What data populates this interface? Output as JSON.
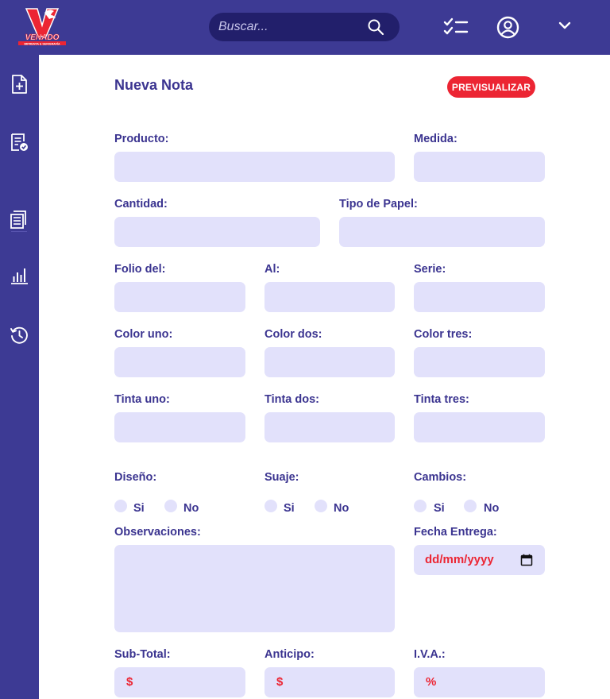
{
  "app": {
    "logo_text": "VENADO",
    "logo_subtitle": "IMPRENTA & SERIGRAFÍA",
    "brand_color": "#3d3a94",
    "accent_color": "#ec2533"
  },
  "topbar": {
    "search_placeholder": "Buscar...",
    "icons": [
      "search-icon",
      "checklist-icon",
      "user-account-icon",
      "chevron-down-icon"
    ]
  },
  "sidebar": {
    "items": [
      {
        "icon": "new-document-icon"
      },
      {
        "icon": "document-check-icon"
      },
      {
        "icon": "notes-list-icon"
      },
      {
        "icon": "bar-chart-icon"
      },
      {
        "icon": "history-icon"
      }
    ]
  },
  "page": {
    "title": "Nueva Nota",
    "preview_button": "PREVISUALIZAR"
  },
  "form": {
    "producto": {
      "label": "Producto:",
      "value": ""
    },
    "medida": {
      "label": "Medida:",
      "value": ""
    },
    "cantidad": {
      "label": "Cantidad:",
      "value": ""
    },
    "tipo_papel": {
      "label": "Tipo de Papel:",
      "value": ""
    },
    "folio_del": {
      "label": "Folio del:",
      "value": ""
    },
    "al": {
      "label": "Al:",
      "value": ""
    },
    "serie": {
      "label": "Serie:",
      "value": ""
    },
    "color_uno": {
      "label": "Color uno:",
      "value": ""
    },
    "color_dos": {
      "label": "Color dos:",
      "value": ""
    },
    "color_tres": {
      "label": "Color tres:",
      "value": ""
    },
    "tinta_uno": {
      "label": "Tinta uno:",
      "value": ""
    },
    "tinta_dos": {
      "label": "Tinta dos:",
      "value": ""
    },
    "tinta_tres": {
      "label": "Tinta tres:",
      "value": ""
    },
    "diseno": {
      "label": "Diseño:",
      "options": [
        "Si",
        "No"
      ],
      "selected": null
    },
    "suaje": {
      "label": "Suaje:",
      "options": [
        "Si",
        "No"
      ],
      "selected": null
    },
    "cambios": {
      "label": "Cambios:",
      "options": [
        "Si",
        "No"
      ],
      "selected": null
    },
    "observaciones": {
      "label": "Observaciones:",
      "value": ""
    },
    "fecha_entrega": {
      "label": "Fecha Entrega:",
      "placeholder": "dd/mm/yyyy"
    },
    "sub_total": {
      "label": "Sub-Total:",
      "prefix": "$",
      "value": ""
    },
    "anticipo": {
      "label": "Anticipo:",
      "prefix": "$",
      "value": ""
    },
    "iva": {
      "label": "I.V.A.:",
      "prefix": "%",
      "value": ""
    }
  }
}
